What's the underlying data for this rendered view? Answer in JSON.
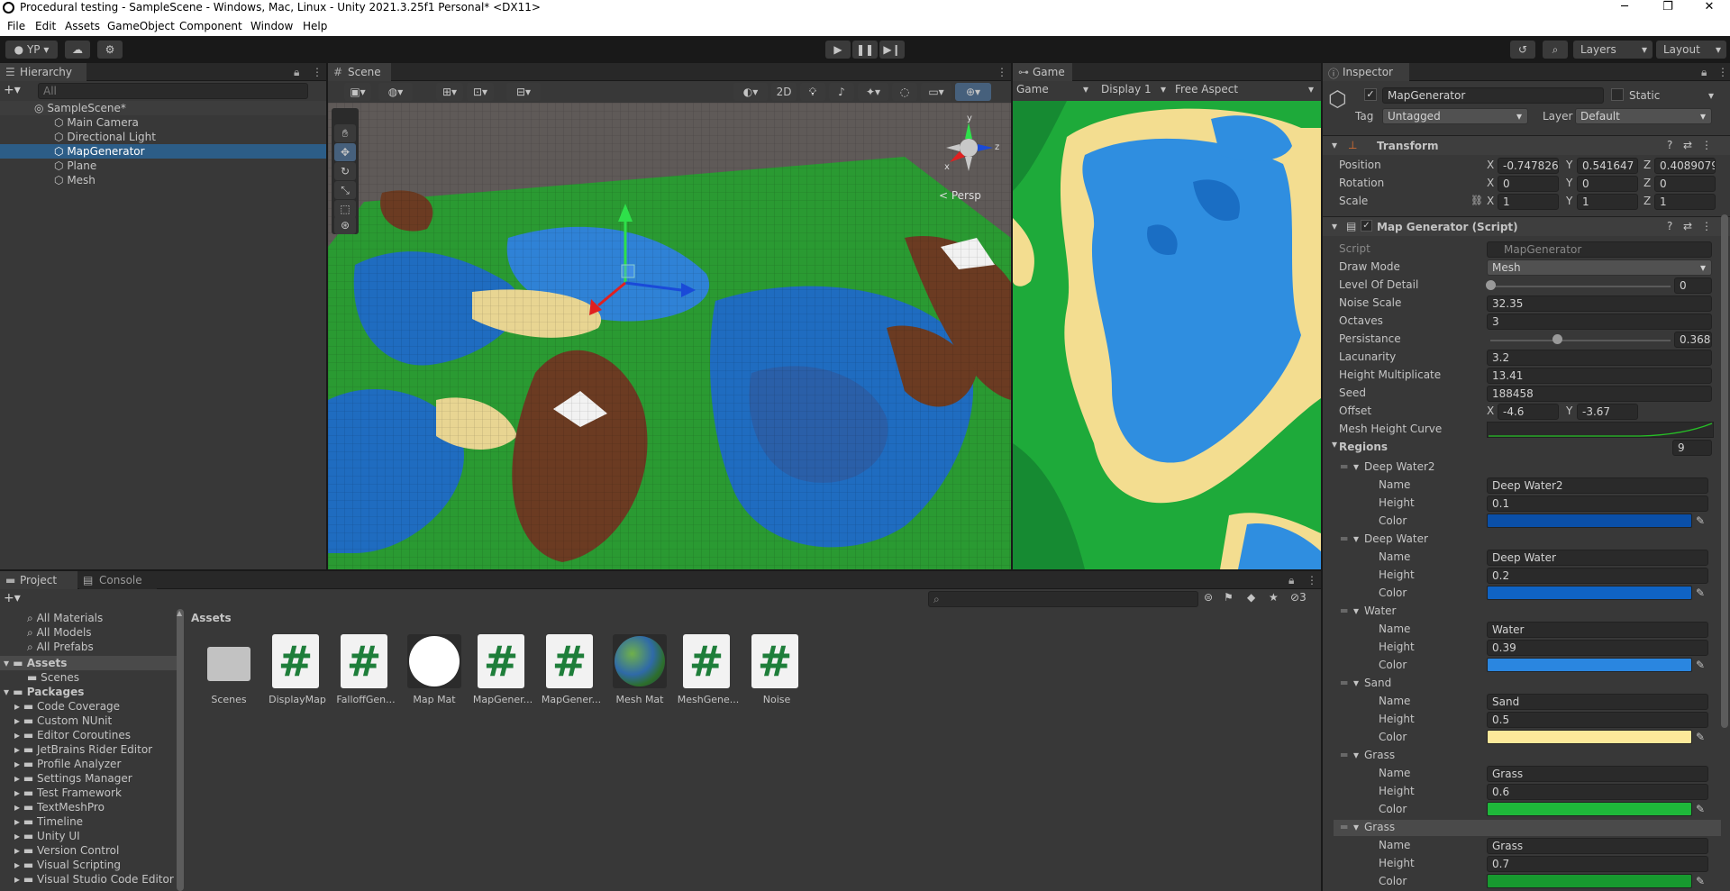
{
  "window": {
    "title": "Procedural testing - SampleScene - Windows, Mac, Linux - Unity 2021.3.25f1 Personal* <DX11>",
    "min": "─",
    "max": "❐",
    "close": "✕"
  },
  "menu": [
    "File",
    "Edit",
    "Assets",
    "GameObject",
    "Component",
    "Window",
    "Help"
  ],
  "toolbar": {
    "account": "YP",
    "layers": "Layers",
    "layout": "Layout"
  },
  "hierarchy": {
    "tab": "Hierarchy",
    "search_placeholder": "All",
    "scene": "SampleScene*",
    "items": [
      "Main Camera",
      "Directional Light",
      "MapGenerator",
      "Plane",
      "Mesh"
    ],
    "selected": "MapGenerator"
  },
  "scene": {
    "tab": "Scene",
    "mode_2d": "2D",
    "persp": "< Persp",
    "gizmo_y": "y",
    "gizmo_x": "x",
    "gizmo_z": "z"
  },
  "game": {
    "tab": "Game",
    "view": "Game",
    "display": "Display 1",
    "aspect": "Free Aspect"
  },
  "inspector": {
    "tab": "Inspector",
    "object_name": "MapGenerator",
    "static": "Static",
    "tag_label": "Tag",
    "tag": "Untagged",
    "layer_label": "Layer",
    "layer": "Default",
    "transform": {
      "title": "Transform",
      "position_label": "Position",
      "rotation_label": "Rotation",
      "scale_label": "Scale",
      "position": {
        "x": "-0.747826",
        "y": "0.541647",
        "z": "0.4089079"
      },
      "rotation": {
        "x": "0",
        "y": "0",
        "z": "0"
      },
      "scale": {
        "x": "1",
        "y": "1",
        "z": "1"
      }
    },
    "script_component": {
      "title": "Map Generator (Script)",
      "script_label": "Script",
      "script": "MapGenerator",
      "draw_mode_label": "Draw Mode",
      "draw_mode": "Mesh",
      "lod_label": "Level Of Detail",
      "lod": "0",
      "lod_fraction": 0.0,
      "noise_scale_label": "Noise Scale",
      "noise_scale": "32.35",
      "octaves_label": "Octaves",
      "octaves": "3",
      "persistance_label": "Persistance",
      "persistance": "0.368",
      "persistance_fraction": 0.368,
      "lacunarity_label": "Lacunarity",
      "lacunarity": "3.2",
      "height_mult_label": "Height Multiplicate",
      "height_mult": "13.41",
      "seed_label": "Seed",
      "seed": "188458",
      "offset_label": "Offset",
      "offset_x": "-4.6",
      "offset_y": "-3.67",
      "curve_label": "Mesh Height Curve",
      "regions_label": "Regions",
      "regions_count": "9"
    },
    "regions": [
      {
        "header": "Deep Water2",
        "name": "Deep Water2",
        "height": "0.1",
        "color": "#0a4fa8"
      },
      {
        "header": "Deep Water",
        "name": "Deep Water",
        "height": "0.2",
        "color": "#0f63c4"
      },
      {
        "header": "Water",
        "name": "Water",
        "height": "0.39",
        "color": "#2a86e0"
      },
      {
        "header": "Sand",
        "name": "Sand",
        "height": "0.5",
        "color": "#fde99a"
      },
      {
        "header": "Grass",
        "name": "Grass",
        "height": "0.6",
        "color": "#1eb83a"
      },
      {
        "header": "Grass",
        "name": "Grass",
        "height": "0.7",
        "color": "#179a2f"
      }
    ],
    "name_label": "Name",
    "height_label": "Height",
    "color_label": "Color"
  },
  "project": {
    "tab_project": "Project",
    "tab_console": "Console",
    "favorites": [
      "All Materials",
      "All Models",
      "All Prefabs"
    ],
    "assets_root": "Assets",
    "assets_children": [
      "Scenes"
    ],
    "packages_root": "Packages",
    "packages": [
      "Code Coverage",
      "Custom NUnit",
      "Editor Coroutines",
      "JetBrains Rider Editor",
      "Profile Analyzer",
      "Settings Manager",
      "Test Framework",
      "TextMeshPro",
      "Timeline",
      "Unity UI",
      "Version Control",
      "Visual Scripting",
      "Visual Studio Code Editor"
    ],
    "breadcrumb": "Assets",
    "hidden_count": "3",
    "grid": [
      {
        "label": "Scenes",
        "kind": "folder"
      },
      {
        "label": "DisplayMap",
        "kind": "script"
      },
      {
        "label": "FalloffGen...",
        "kind": "script"
      },
      {
        "label": "Map Mat",
        "kind": "material-white"
      },
      {
        "label": "MapGener...",
        "kind": "script"
      },
      {
        "label": "MapGener...",
        "kind": "script"
      },
      {
        "label": "Mesh Mat",
        "kind": "material-terrain"
      },
      {
        "label": "MeshGene...",
        "kind": "script"
      },
      {
        "label": "Noise",
        "kind": "script"
      }
    ]
  }
}
